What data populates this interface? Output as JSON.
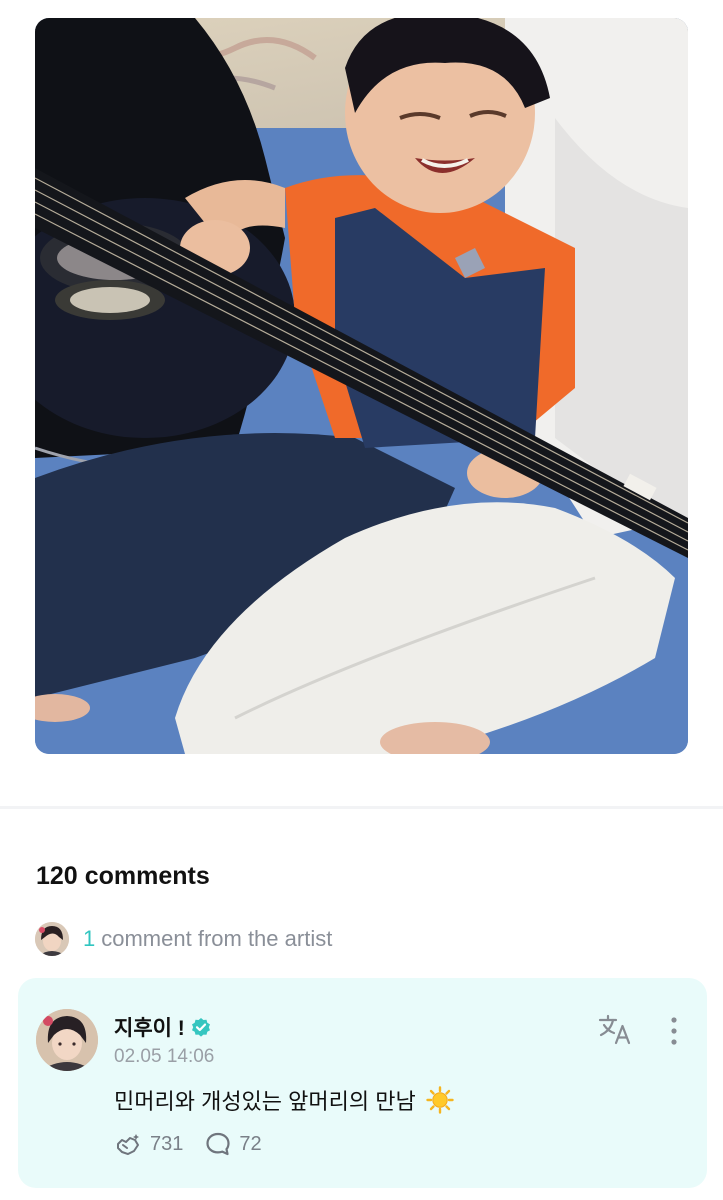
{
  "post": {
    "image_alt": "Photo of a toddler in an orange shirt and denim overalls playing a black acoustic guitar"
  },
  "comments": {
    "count": "120",
    "count_label": "comments",
    "artist_count": "1",
    "artist_label": "comment from the artist"
  },
  "artist_comment": {
    "author": "지후이 !",
    "verified": true,
    "timestamp": "02.05 14:06",
    "text": "민머리와 개성있는 앞머리의 만남",
    "likes": "731",
    "replies": "72"
  },
  "icons": {
    "verified": "verified-check-badge-icon",
    "translate": "translate-icon",
    "more": "more-vertical-icon",
    "like": "like-icon",
    "reply": "reply-bubble-icon",
    "emoji": "sun-emoji"
  },
  "colors": {
    "accent": "#31c5c0",
    "card_background": "#e9fbfa",
    "muted_text": "#8a8f98"
  }
}
